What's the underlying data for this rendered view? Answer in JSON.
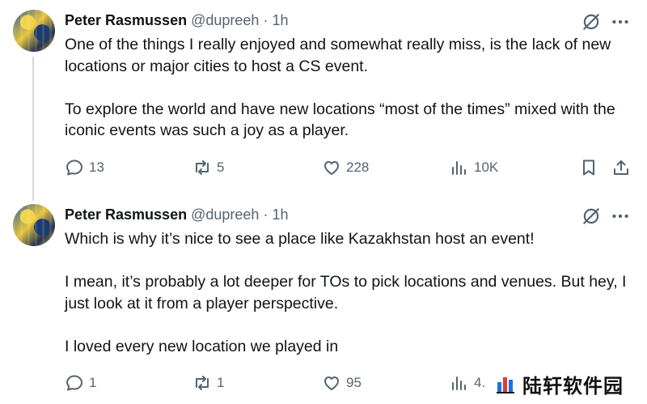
{
  "tweets": [
    {
      "author": {
        "name": "Peter Rasmussen",
        "handle": "@dupreeh",
        "separator": "·",
        "time": "1h"
      },
      "text": "One of the things I really enjoyed and somewhat really miss, is the lack of new locations or major cities to host a CS event.\n\nTo explore the world and have new locations “most of the times” mixed with the iconic events was such a joy as a player.",
      "stats": {
        "replies": "13",
        "reposts": "5",
        "likes": "228",
        "views": "10K"
      }
    },
    {
      "author": {
        "name": "Peter Rasmussen",
        "handle": "@dupreeh",
        "separator": "·",
        "time": "1h"
      },
      "text": "Which is why it’s nice to see a place like Kazakhstan host an event!\n\nI mean, it’s probably a lot deeper for TOs to pick locations and venues. But hey, I just look at it from a player perspective.\n\nI loved every new location we played in",
      "stats": {
        "replies": "1",
        "reposts": "1",
        "likes": "95",
        "views": "4."
      }
    }
  ],
  "watermark": {
    "text": "陆轩软件园"
  },
  "colors": {
    "text": "#0f1419",
    "secondary": "#536471",
    "thread_line": "#cfd9de",
    "background": "#ffffff"
  },
  "icons": [
    "grok-icon",
    "more-icon",
    "reply-icon",
    "repost-icon",
    "like-icon",
    "views-icon",
    "bookmark-icon",
    "share-icon"
  ]
}
